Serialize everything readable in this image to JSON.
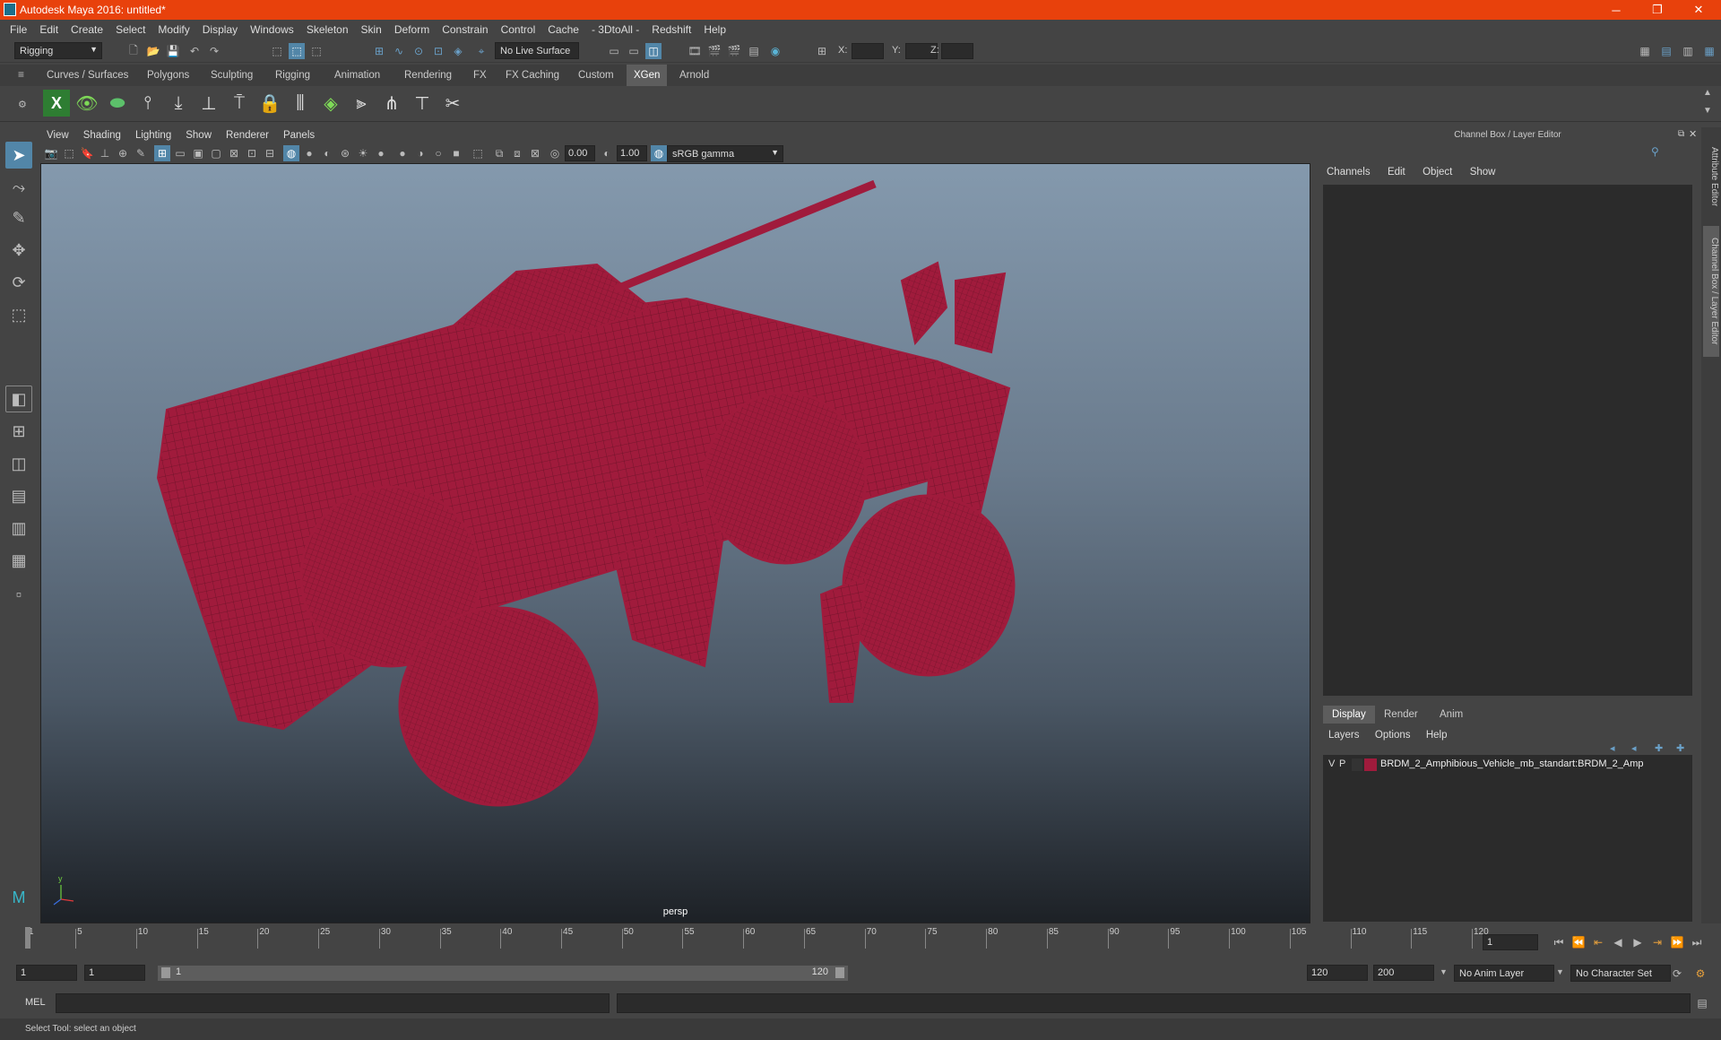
{
  "window": {
    "title": "Autodesk Maya 2016: untitled*",
    "minimize": "─",
    "restore": "❐",
    "close": "✕"
  },
  "menubar": [
    "File",
    "Edit",
    "Create",
    "Select",
    "Modify",
    "Display",
    "Windows",
    "Skeleton",
    "Skin",
    "Deform",
    "Constrain",
    "Control",
    "Cache",
    "- 3DtoAll -",
    "Redshift",
    "Help"
  ],
  "statusline": {
    "menuset": "Rigging",
    "live_surface": "No Live Surface",
    "x_label": "X:",
    "y_label": "Y:",
    "z_label": "Z:"
  },
  "shelf": {
    "tabs": [
      "Curves / Surfaces",
      "Polygons",
      "Sculpting",
      "Rigging",
      "Animation",
      "Rendering",
      "FX",
      "FX Caching",
      "Custom",
      "XGen",
      "Arnold"
    ],
    "active_tab": "XGen"
  },
  "panel": {
    "menus": [
      "View",
      "Shading",
      "Lighting",
      "Show",
      "Renderer",
      "Panels"
    ],
    "exposure": "0.00",
    "gamma": "1.00",
    "color_space": "sRGB gamma",
    "camera": "persp"
  },
  "channel_box": {
    "title": "Channel Box / Layer Editor",
    "menus": [
      "Channels",
      "Edit",
      "Object",
      "Show"
    ],
    "layer_tabs": [
      "Display",
      "Render",
      "Anim"
    ],
    "active_layer_tab": "Display",
    "layer_menus": [
      "Layers",
      "Options",
      "Help"
    ],
    "layer": {
      "visible": "V",
      "playback": "P",
      "color": "#a01b3c",
      "name": "BRDM_2_Amphibious_Vehicle_mb_standart:BRDM_2_Amp"
    }
  },
  "side_tabs": [
    "Attribute Editor",
    "Channel Box / Layer Editor"
  ],
  "timeline": {
    "ticks": [
      "1",
      "5",
      "10",
      "15",
      "20",
      "25",
      "30",
      "35",
      "40",
      "45",
      "50",
      "55",
      "60",
      "65",
      "70",
      "75",
      "80",
      "85",
      "90",
      "95",
      "100",
      "105",
      "110",
      "115",
      "120"
    ],
    "current_frame": "1"
  },
  "range": {
    "start": "1",
    "anim_start": "1",
    "slider_start": "1",
    "slider_end": "120",
    "anim_end": "120",
    "end": "200",
    "anim_layer": "No Anim Layer",
    "character_set": "No Character Set"
  },
  "cmdline": {
    "label": "MEL"
  },
  "helpline": {
    "text": "Select Tool: select an object"
  },
  "colors": {
    "title_bar": "#e8410c",
    "wireframe": "#a01b3c",
    "active_tab": "#5d5d5d",
    "active_tool": "#5286a8"
  }
}
